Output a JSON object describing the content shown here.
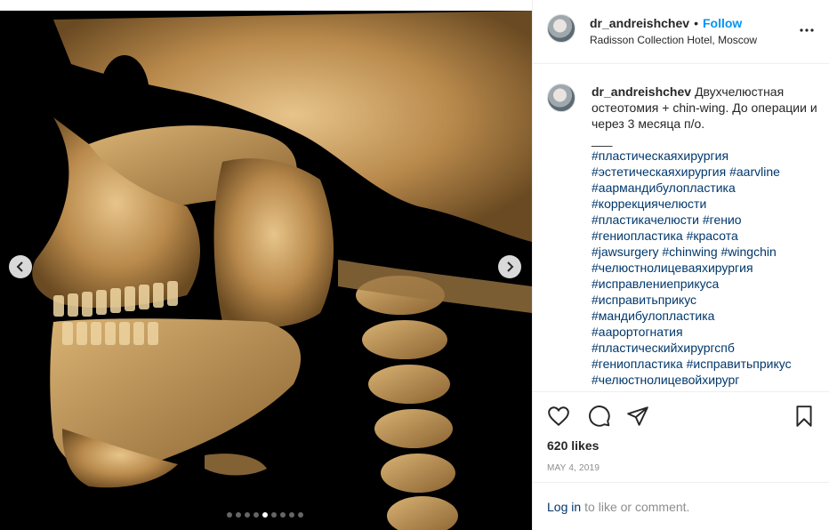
{
  "post": {
    "username": "dr_andreishchev",
    "separator": "•",
    "follow_label": "Follow",
    "location": "Radisson Collection Hotel, Moscow",
    "caption_text": "Двухчелюстная остеотомия + chin-wing. До операции и через 3 месяца п/о.",
    "caption_separator": "___",
    "hashtag_lines": [
      "#пластическаяхирургия",
      "#эстетическаяхирургия #aarvline",
      "#аармандибулопластика",
      "#коррекциячелюсти",
      "#пластикачелюсти #генио",
      "#гениопластика #красота",
      "#jawsurgery #chinwing #wingchin",
      "#челюстнолицеваяхирургия",
      "#исправлениеприкуса",
      "#исправитьприкус",
      "#мандибулопластика",
      "#аарортогнатия",
      "#пластическийхирургспб",
      "#гениопластика #исправитьприкус",
      "#челюстнолицевойхирург"
    ],
    "likes": "620 likes",
    "date": "MAY 4, 2019"
  },
  "login": {
    "link": "Log in",
    "rest": "to like or comment."
  },
  "carousel": {
    "slide_count": 9,
    "active_index": 4
  },
  "icons": {
    "more": "more-options-icon",
    "like": "heart-icon",
    "comment": "comment-icon",
    "share": "paper-plane-icon",
    "save": "bookmark-icon",
    "prev": "chevron-left-icon",
    "next": "chevron-right-icon"
  },
  "colors": {
    "link_blue": "#0095f6",
    "hashtag": "#00376b",
    "muted": "#8e8e8e"
  }
}
